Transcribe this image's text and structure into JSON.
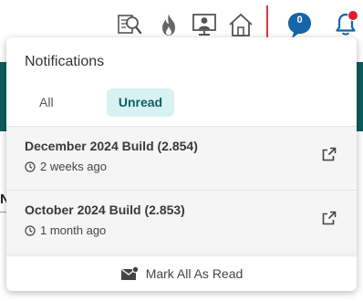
{
  "toolbar": {
    "icons": [
      "search-document-icon",
      "flame-icon",
      "user-monitor-icon",
      "home-icon"
    ],
    "messages_count": "0",
    "accent_color": "#1565a8",
    "alert_color": "#e01b2a"
  },
  "notifications": {
    "title": "Notifications",
    "tabs": [
      {
        "label": "All",
        "active": false
      },
      {
        "label": "Unread",
        "active": true
      }
    ],
    "items": [
      {
        "title": "December 2024 Build (2.854)",
        "time": "2 weeks ago"
      },
      {
        "title": "October 2024 Build (2.853)",
        "time": "1 month ago"
      }
    ],
    "mark_all_label": "Mark All As Read"
  },
  "background": {
    "partial_letter": "N",
    "header_color": "#0e5c5f"
  }
}
